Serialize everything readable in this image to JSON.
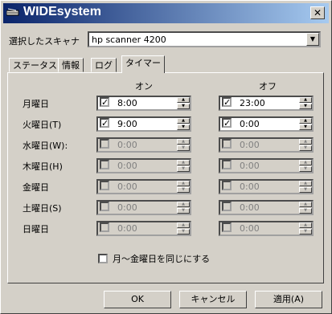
{
  "window": {
    "title": "WIDEsystem"
  },
  "scanner": {
    "label": "選択したスキャナ",
    "selected": "hp scanner 4200"
  },
  "tabs": [
    "ステータス",
    "情報",
    "ログ",
    "タイマー"
  ],
  "active_tab": "タイマー",
  "timer": {
    "col_on": "オン",
    "col_off": "オフ",
    "days": [
      {
        "label": "月曜日",
        "on_checked": true,
        "on_time": "8:00",
        "off_checked": true,
        "off_time": "23:00",
        "enabled": true
      },
      {
        "label": "火曜日(T)",
        "on_checked": true,
        "on_time": "9:00",
        "off_checked": true,
        "off_time": "0:00",
        "enabled": true
      },
      {
        "label": "水曜日(W):",
        "on_checked": false,
        "on_time": "0:00",
        "off_checked": false,
        "off_time": "0:00",
        "enabled": false
      },
      {
        "label": "木曜日(H)",
        "on_checked": false,
        "on_time": "0:00",
        "off_checked": false,
        "off_time": "0:00",
        "enabled": false
      },
      {
        "label": "金曜日",
        "on_checked": false,
        "on_time": "0:00",
        "off_checked": false,
        "off_time": "0:00",
        "enabled": false
      },
      {
        "label": "土曜日(S)",
        "on_checked": false,
        "on_time": "0:00",
        "off_checked": false,
        "off_time": "0:00",
        "enabled": false
      },
      {
        "label": "日曜日",
        "on_checked": false,
        "on_time": "0:00",
        "off_checked": false,
        "off_time": "0:00",
        "enabled": false
      }
    ],
    "same_weekday_label": "月～金曜日を同じにする"
  },
  "buttons": {
    "ok": "OK",
    "cancel": "キャンセル",
    "apply": "適用(A)"
  }
}
